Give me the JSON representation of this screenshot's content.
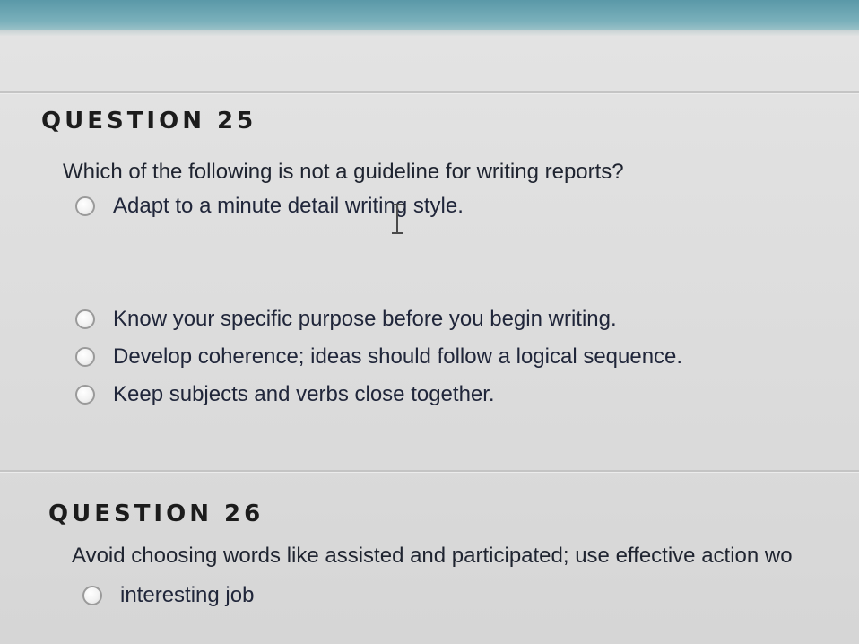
{
  "q25": {
    "heading": "QUESTION 25",
    "question": "Which of the following is not a guideline for writing reports?",
    "options": [
      {
        "label": "Adapt to a minute detail writing style.",
        "selected": false
      },
      {
        "label": "Know your specific purpose before you begin writing.",
        "selected": false
      },
      {
        "label": "Develop coherence; ideas should follow a logical sequence.",
        "selected": false
      },
      {
        "label": "Keep subjects and verbs close together.",
        "selected": false
      }
    ]
  },
  "q26": {
    "heading": "QUESTION 26",
    "question": "Avoid choosing words like assisted and participated; use effective action wo",
    "options": [
      {
        "label": "interesting job",
        "selected": false
      }
    ]
  },
  "icons": {
    "cursor": "text-cursor-icon",
    "radio": "radio-button-icon"
  },
  "colors": {
    "top_band": "#5a98a8",
    "background": "#dcdcdc",
    "text": "#1f2430"
  }
}
